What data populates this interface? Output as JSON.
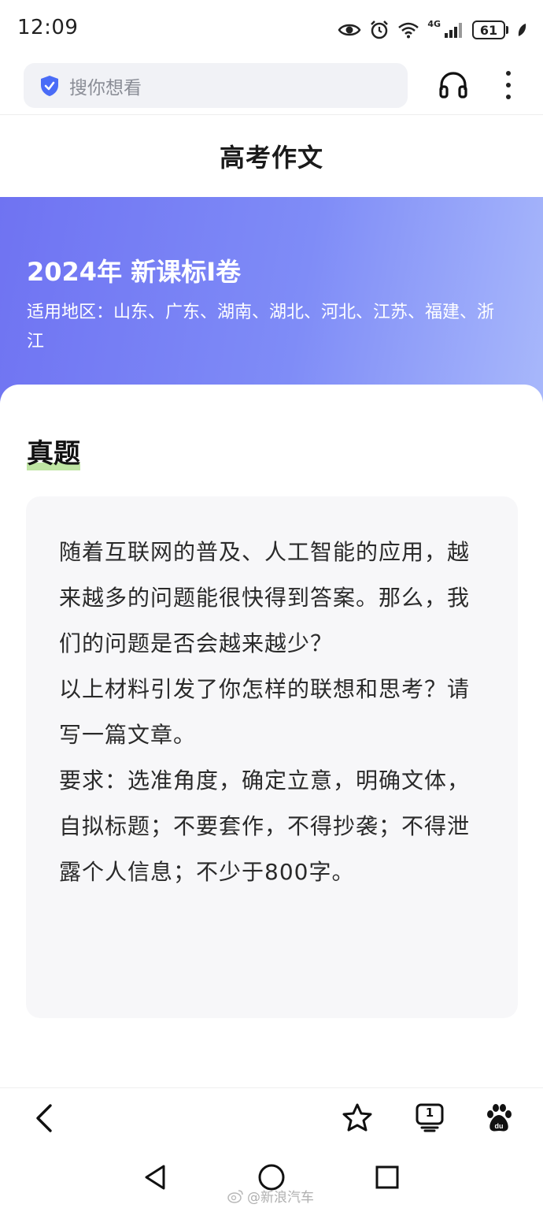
{
  "status_bar": {
    "time": "12:09",
    "network": "4G",
    "battery": "61",
    "icons": [
      "eye-icon",
      "alarm-icon",
      "wifi-icon",
      "signal-icon",
      "battery-icon",
      "leaf-icon"
    ]
  },
  "search": {
    "placeholder": "搜你想看",
    "icons": [
      "shield-icon",
      "headphones-icon",
      "more-vertical-icon"
    ]
  },
  "page": {
    "title": "高考作文"
  },
  "hero": {
    "heading": "2024年 新课标I卷",
    "regions": "适用地区：山东、广东、湖南、湖北、河北、江苏、福建、浙江"
  },
  "content": {
    "section_title": "真题",
    "paragraphs": [
      "随着互联网的普及、人工智能的应用，越来越多的问题能很快得到答案。那么，我们的问题是否会越来越少？",
      "以上材料引发了你怎样的联想和思考？请写一篇文章。",
      "要求：选准角度，确定立意，明确文体，自拟标题；不要套作，不得抄袭；不得泄露个人信息；不少于800字。"
    ]
  },
  "browser_bar": {
    "tab_count": "1",
    "icons": [
      "back-arrow-icon",
      "star-icon",
      "tabs-icon",
      "baidu-paw-icon"
    ]
  },
  "nav_bar": {
    "icons": [
      "back-triangle-icon",
      "home-circle-icon",
      "recents-square-icon"
    ]
  },
  "watermark": "@新浪汽车",
  "colors": {
    "hero_gradient_start": "#6f73f2",
    "hero_gradient_end": "#a8b8fb",
    "shield": "#4a6cf7",
    "highlight": "#bfe5a3",
    "question_bg": "#f7f7f9"
  }
}
